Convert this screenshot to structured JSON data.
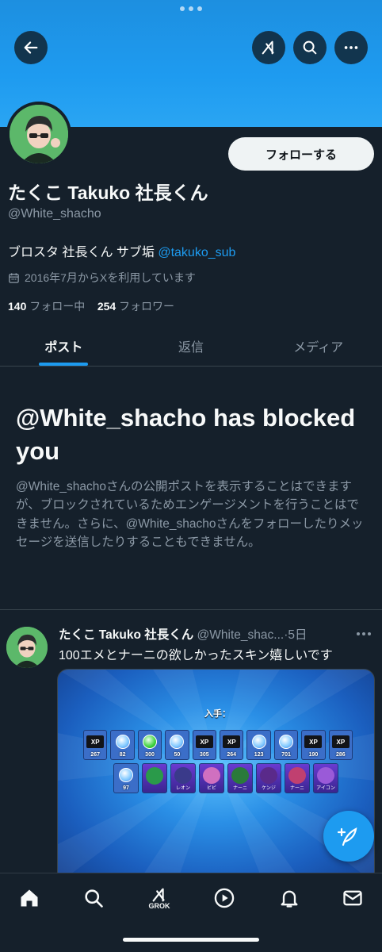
{
  "colors": {
    "accent": "#1d9bf0",
    "background": "#15202b",
    "text": "#f7f9f9",
    "muted": "#8b98a5"
  },
  "header": {
    "icons": [
      "back-arrow-icon",
      "grok-icon",
      "search-icon",
      "more-icon"
    ]
  },
  "profile": {
    "display_name": "たくこ Takuko 社長くん",
    "handle": "@White_shacho",
    "bio_text": "ブロスタ 社長くん サブ垢 ",
    "bio_link": "@takuko_sub",
    "joined": "2016年7月からXを利用しています",
    "following_count": "140",
    "following_label": " フォロー中",
    "followers_count": "254",
    "followers_label": " フォロワー",
    "follow_button": "フォローする"
  },
  "tabs": [
    {
      "label": "ポスト",
      "active": true
    },
    {
      "label": "返信",
      "active": false
    },
    {
      "label": "メディア",
      "active": false
    }
  ],
  "blocked": {
    "title": "@White_shacho has blocked you",
    "description": "@White_shachoさんの公開ポストを表示することはできますが、ブロックされているためエンゲージメントを行うことはできません。さらに、@White_shachoさんをフォローしたりメッセージを送信したりすることもできません。"
  },
  "post": {
    "display_name": "たくこ Takuko 社長くん",
    "handle": "@White_shac...",
    "time": "·5日",
    "text": "100エメとナーニの欲しかったスキン嬉しいです",
    "media": {
      "label": "入手：",
      "row1": [
        {
          "kind": "xp",
          "num": "267"
        },
        {
          "kind": "gem",
          "num": "82"
        },
        {
          "kind": "green",
          "num": "300"
        },
        {
          "kind": "gem",
          "num": "50"
        },
        {
          "kind": "xp",
          "num": "305"
        },
        {
          "kind": "xp",
          "num": "264"
        },
        {
          "kind": "gem",
          "num": "123"
        },
        {
          "kind": "gem",
          "num": "701"
        },
        {
          "kind": "xp",
          "num": "190"
        },
        {
          "kind": "xp",
          "num": "286"
        }
      ],
      "row2": [
        {
          "kind": "gem",
          "num": "97",
          "cap": ""
        },
        {
          "kind": "char",
          "num": "",
          "cap": ""
        },
        {
          "kind": "char",
          "num": "",
          "cap": "レオン"
        },
        {
          "kind": "char",
          "num": "",
          "cap": "ビビ"
        },
        {
          "kind": "char",
          "num": "",
          "cap": "ナーニ"
        },
        {
          "kind": "char",
          "num": "",
          "cap": "ケンジ"
        },
        {
          "kind": "char",
          "num": "",
          "cap": "ナーニ"
        },
        {
          "kind": "char",
          "num": "",
          "cap": "アイコン"
        }
      ]
    }
  },
  "bottom_nav": {
    "grok_label": "GROK",
    "icons": [
      "home-icon",
      "search-icon",
      "grok-icon",
      "video-icon",
      "notifications-icon",
      "messages-icon"
    ]
  }
}
